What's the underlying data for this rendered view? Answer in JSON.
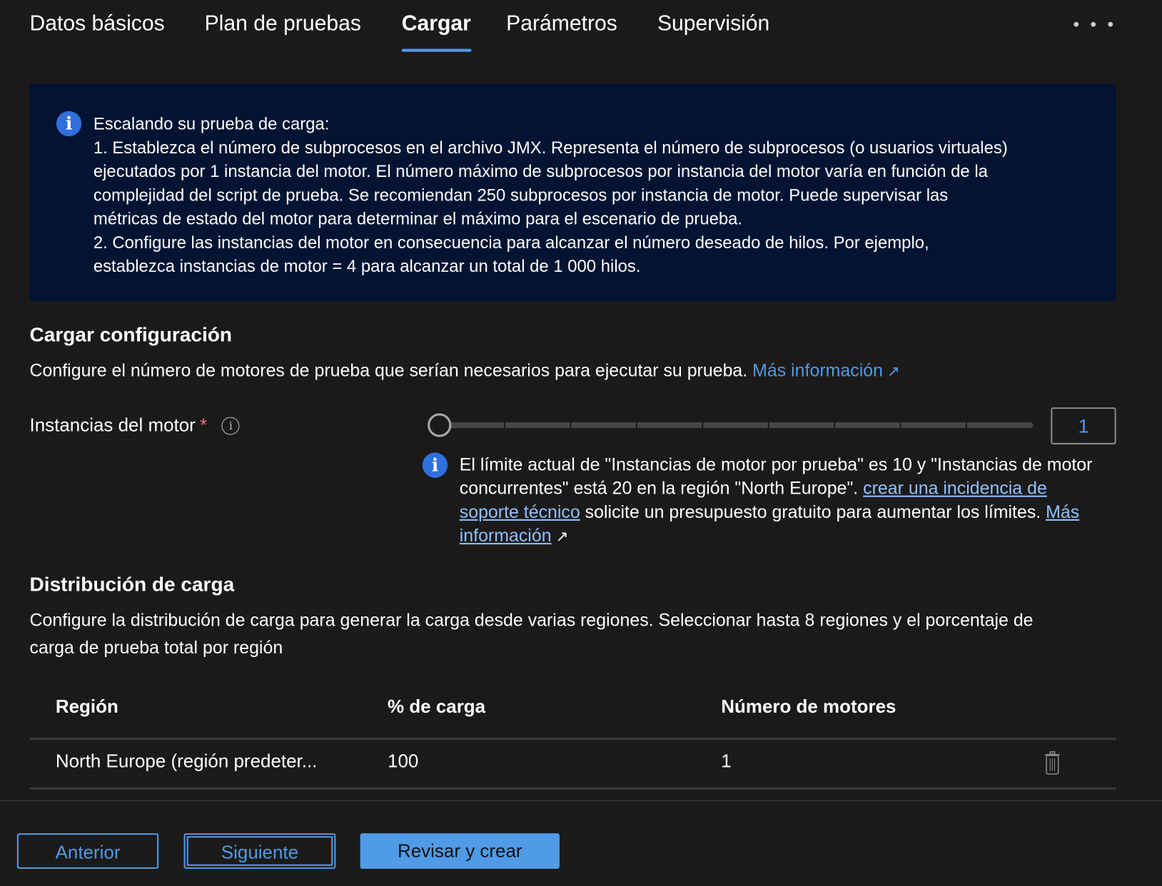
{
  "tabs": [
    {
      "label": "Datos básicos"
    },
    {
      "label": "Plan de pruebas"
    },
    {
      "label": "Cargar",
      "active": true
    },
    {
      "label": "Parámetros"
    },
    {
      "label": "Supervisión"
    }
  ],
  "more_label": "• • •",
  "banner": {
    "icon": "info-icon",
    "lines": [
      "Escalando su prueba de carga:",
      "1. Establezca el número de subprocesos en el archivo JMX. Representa el número de subprocesos (o usuarios virtuales)",
      "ejecutados por 1 instancia del motor. El número máximo de subprocesos por instancia del motor varía en función de la",
      "complejidad del script de prueba. Se recomiendan 250 subprocesos por instancia de motor. Puede supervisar las",
      "métricas de estado del motor para determinar el máximo para el escenario de prueba.",
      "2. Configure las instancias del motor en consecuencia para alcanzar el número deseado de hilos. Por ejemplo,",
      "establezca instancias de motor = 4 para alcanzar un total de 1 000 hilos."
    ]
  },
  "load_config": {
    "title": "Cargar configuración",
    "description": "Configure el número de motores de prueba que serían necesarios para ejecutar su prueba.",
    "more_info": "Más información",
    "engine_label": "Instancias del motor",
    "required": "*",
    "info_glyph": "i",
    "engine_value": "1",
    "slider": {
      "min": 1,
      "max": 10,
      "value": 1
    },
    "limit_text_1": "El límite actual de \"Instancias de motor por prueba\" es 10 y \"Instancias de motor concurrentes\" está 20 en la región \"North Europe\".",
    "limit_link": "crear una incidencia de soporte técnico",
    "limit_text_2": "solicite un presupuesto gratuito para aumentar los límites.",
    "limit_more_info": "Más información"
  },
  "distribution": {
    "title": "Distribución de carga",
    "description": "Configure la distribución de carga para generar la carga desde varias regiones. Seleccionar hasta 8 regiones y el porcentaje de carga de prueba total por región",
    "columns": [
      "Región",
      "% de carga",
      "Número de motores"
    ],
    "rows": [
      {
        "region": "North Europe (región predeter...",
        "load": "100",
        "engines": "1"
      }
    ]
  },
  "footer": {
    "previous": "Anterior",
    "next": "Siguiente",
    "review": "Revisar y crear"
  },
  "colors": {
    "accent": "#4f9be8",
    "banner_bg": "#021432",
    "background": "#1b1a19"
  }
}
